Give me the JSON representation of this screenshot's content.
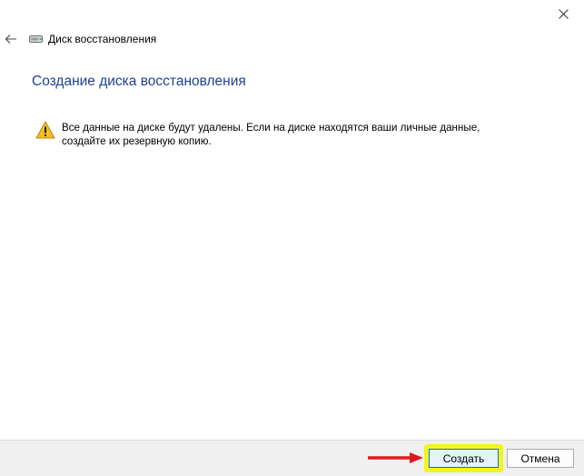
{
  "window": {
    "close_glyph": "✕"
  },
  "nav": {
    "title": "Диск восстановления"
  },
  "main": {
    "heading": "Создание диска восстановления",
    "warning_line1": "Все данные на диске будут удалены. Если на диске находятся ваши личные данные,",
    "warning_line2": "создайте их резервную копию."
  },
  "footer": {
    "create_label": "Создать",
    "cancel_label": "Отмена"
  },
  "colors": {
    "heading": "#1e3f96",
    "highlight": "#f4f51c",
    "arrow": "#e0181b",
    "primary_border": "#0078d7"
  },
  "icons": [
    "close-icon",
    "back-arrow-icon",
    "drive-icon",
    "warning-icon",
    "red-arrow-icon"
  ]
}
